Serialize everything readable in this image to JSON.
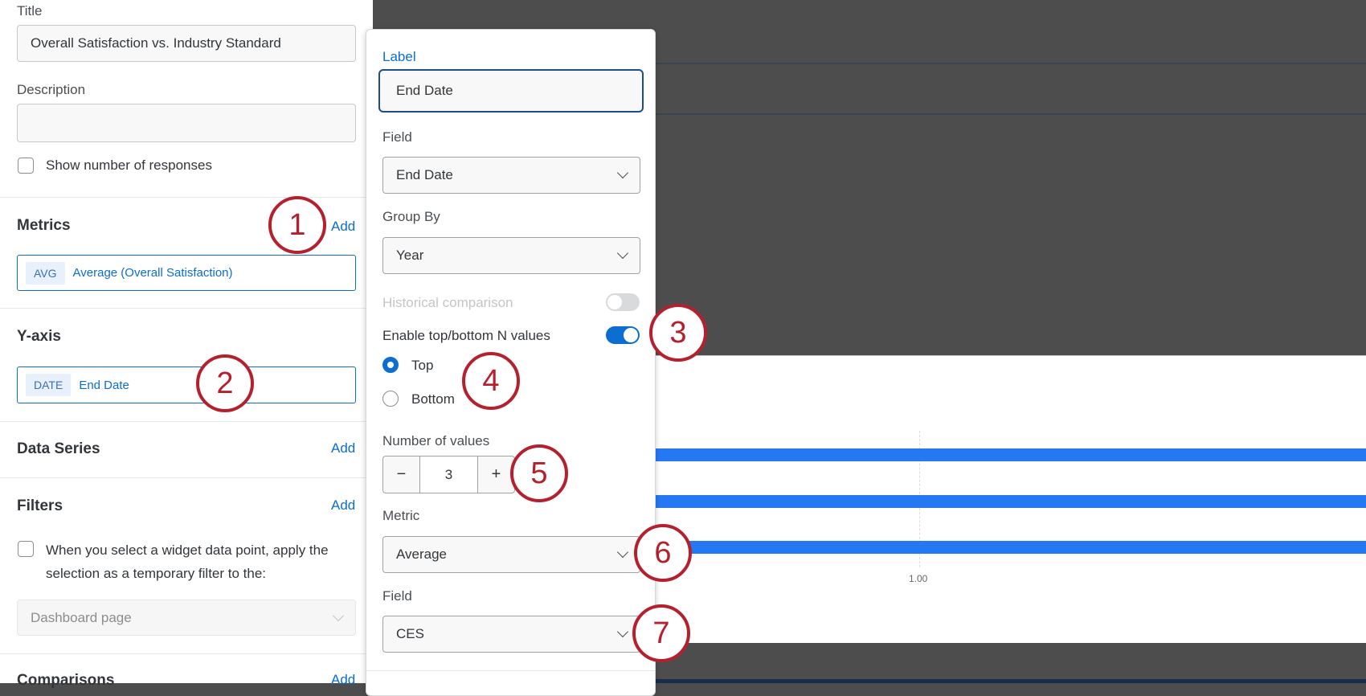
{
  "left": {
    "title_label": "Title",
    "title_value": "Overall Satisfaction vs. Industry Standard",
    "description_label": "Description",
    "description_value": "",
    "show_responses": "Show number of responses",
    "metrics_heading": "Metrics",
    "metrics_add": "Add",
    "metric_tag": "AVG",
    "metric_name": "Average (Overall Satisfaction)",
    "yaxis_heading": "Y-axis",
    "yaxis_tag": "DATE",
    "yaxis_name": "End Date",
    "series_heading": "Data Series",
    "series_add": "Add",
    "filters_heading": "Filters",
    "filters_add": "Add",
    "filter_checkbox_line1": "When you select a widget data point, apply the",
    "filter_checkbox_line2": "selection as a temporary filter to the:",
    "filter_target": "Dashboard page",
    "comparisons_heading": "Comparisons",
    "comparisons_add": "Add"
  },
  "popup": {
    "label_label": "Label",
    "label_value": "End Date",
    "field_label": "Field",
    "field_value": "End Date",
    "groupby_label": "Group By",
    "groupby_value": "Year",
    "historical_label": "Historical comparison",
    "historical_on": false,
    "topn_label": "Enable top/bottom N values",
    "topn_on": true,
    "radio_top": "Top",
    "radio_bottom": "Bottom",
    "selected": "Top",
    "num_values_label": "Number of values",
    "num_values": "3",
    "minus": "−",
    "plus": "+",
    "metric_label": "Metric",
    "metric_value": "Average",
    "field2_label": "Field",
    "field2_value": "CES"
  },
  "annotations": [
    "1",
    "2",
    "3",
    "4",
    "5",
    "6",
    "7"
  ],
  "chart_data": {
    "type": "bar",
    "orientation": "horizontal",
    "bar_count": 3,
    "xticks": [
      "1.00"
    ],
    "color": "#2479f2"
  }
}
